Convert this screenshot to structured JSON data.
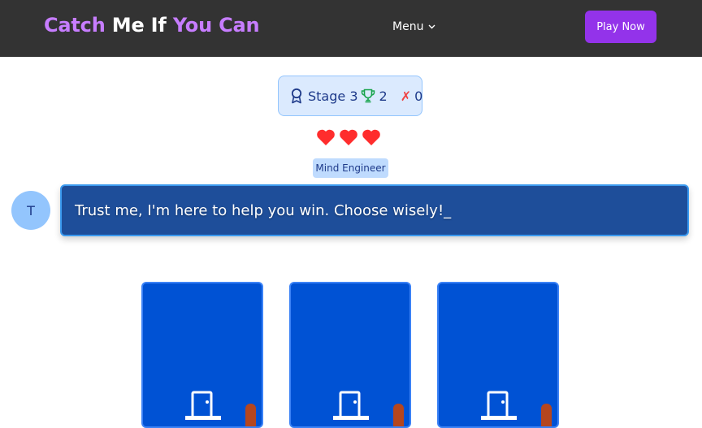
{
  "navbar": {
    "brand_part1": "Catch",
    "brand_part2": "Me If",
    "brand_part3": "You Can",
    "menu_label": "Menu",
    "play_label": "Play Now"
  },
  "stats": {
    "stage_label": "Stage 3",
    "wins": "2",
    "losses": "0"
  },
  "lives": {
    "count": 3
  },
  "role": {
    "label": "Mind Engineer"
  },
  "dialog": {
    "avatar_letter": "T",
    "message": "Trust me, I'm here to help you win. Choose wisely!_"
  },
  "doors": [
    {
      "icon": "door-icon"
    },
    {
      "icon": "door-icon"
    },
    {
      "icon": "door-icon"
    }
  ],
  "colors": {
    "navbar_bg": "#333333",
    "brand_accent": "#c77dff",
    "play_button": "#9333ea",
    "door": "#0052d4",
    "bubble": "#1e4e9a",
    "heart": "#ff2d2d"
  }
}
